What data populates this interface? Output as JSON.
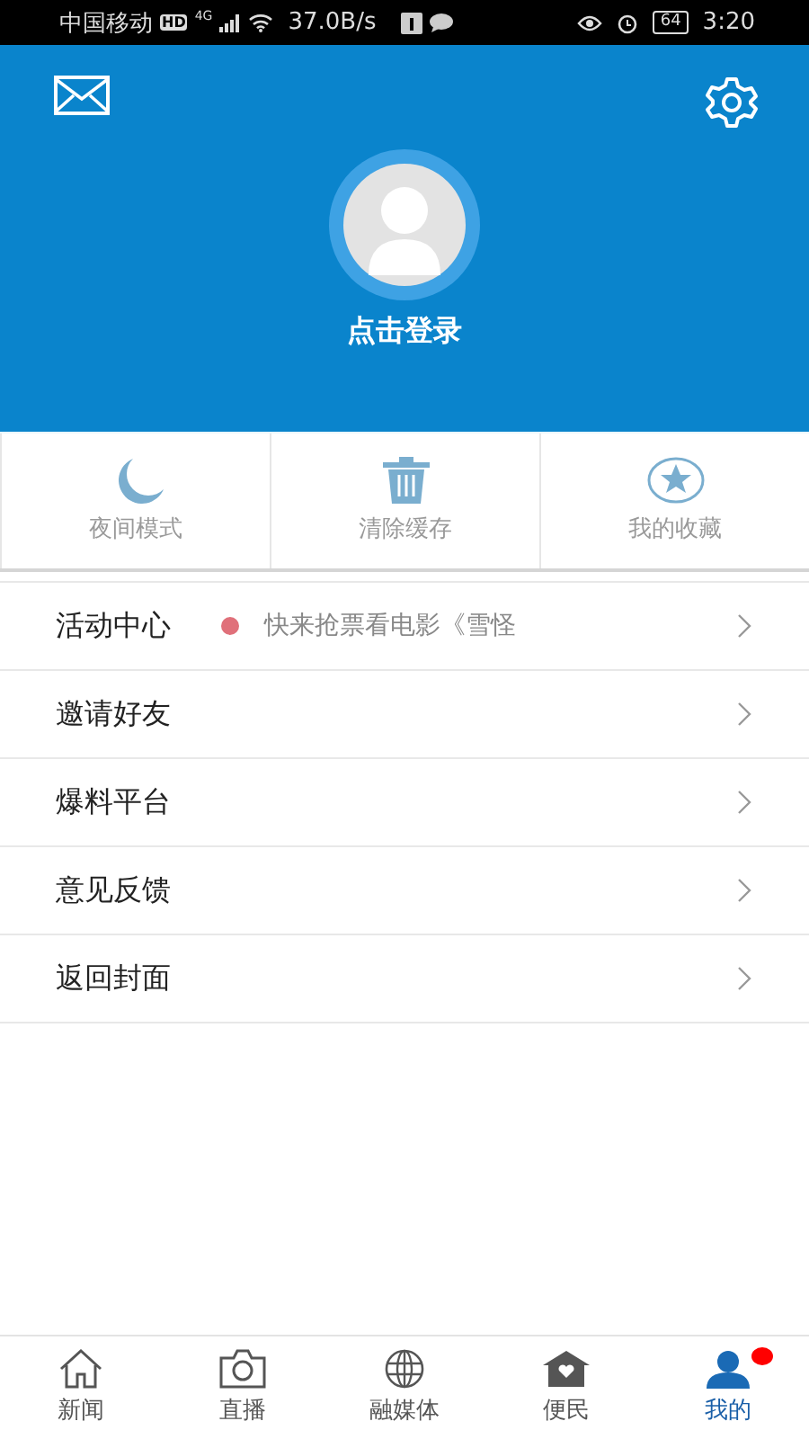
{
  "status_bar": {
    "carrier": "中国移动",
    "hd_badge": "HD",
    "network": "4G",
    "speed": "37.0B/s",
    "battery": "64",
    "time": "3:20"
  },
  "header": {
    "login_label": "点击登录"
  },
  "quick_actions": [
    {
      "kind": "moon",
      "label": "夜间模式"
    },
    {
      "kind": "trash",
      "label": "清除缓存"
    },
    {
      "kind": "star",
      "label": "我的收藏"
    }
  ],
  "menu": [
    {
      "label": "活动中心",
      "note": "快来抢票看电影《雪怪",
      "color": "#e0707a"
    },
    {
      "label": "邀请好友"
    },
    {
      "label": "爆料平台"
    },
    {
      "label": "意见反馈"
    },
    {
      "label": "返回封面"
    }
  ],
  "tabs": [
    {
      "kind": "home",
      "label": "新闻",
      "selected": false,
      "badge": false
    },
    {
      "kind": "camera",
      "label": "直播",
      "selected": false,
      "badge": false
    },
    {
      "kind": "globe",
      "label": "融媒体",
      "selected": false,
      "badge": false
    },
    {
      "kind": "house",
      "label": "便民",
      "selected": false,
      "badge": false
    },
    {
      "kind": "person",
      "label": "我的",
      "selected": true,
      "badge": true
    }
  ]
}
